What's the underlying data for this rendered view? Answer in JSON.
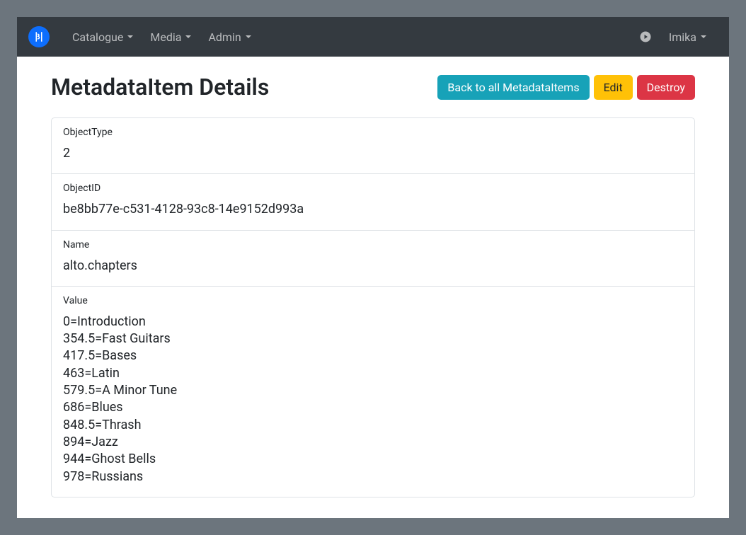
{
  "nav": {
    "items": [
      "Catalogue",
      "Media",
      "Admin"
    ],
    "user": "Imika"
  },
  "header": {
    "title": "MetadataItem Details",
    "buttons": {
      "back": "Back to all MetadataItems",
      "edit": "Edit",
      "destroy": "Destroy"
    }
  },
  "fields": {
    "objectType": {
      "label": "ObjectType",
      "value": "2"
    },
    "objectId": {
      "label": "ObjectID",
      "value": "be8bb77e-c531-4128-93c8-14e9152d993a"
    },
    "name": {
      "label": "Name",
      "value": "alto.chapters"
    },
    "value": {
      "label": "Value",
      "value": "0=Introduction\n354.5=Fast Guitars\n417.5=Bases\n463=Latin\n579.5=A Minor Tune\n686=Blues\n848.5=Thrash\n894=Jazz\n944=Ghost Bells\n978=Russians"
    }
  }
}
